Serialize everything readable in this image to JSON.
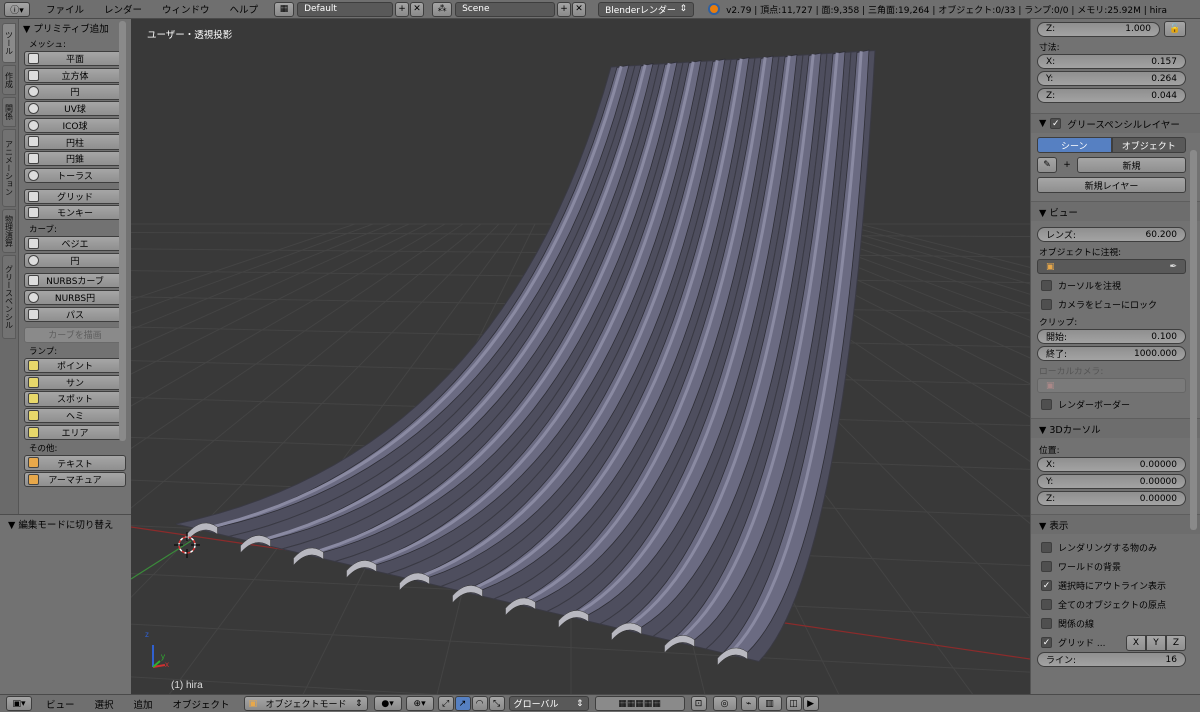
{
  "topbar": {
    "menus": [
      "ファイル",
      "レンダー",
      "ウィンドウ",
      "ヘルプ"
    ],
    "layout": "Default",
    "scene": "Scene",
    "engine": "Blenderレンダー",
    "stats": "v2.79 | 頂点:11,727 | 面:9,358 | 三角面:19,264 | オブジェクト:0/33 | ランプ:0/0 | メモリ:25.92M | hira"
  },
  "tabs": [
    "ツール",
    "作成",
    "関係",
    "アニメーション",
    "物理演算",
    "グリースペンシル"
  ],
  "tools": {
    "header": "▼ プリミティブ追加",
    "mesh_label": "メッシュ:",
    "mesh": [
      "平面",
      "立方体",
      "円",
      "UV球",
      "ICO球",
      "円柱",
      "円錐",
      "トーラス"
    ],
    "mesh2": [
      "グリッド",
      "モンキー"
    ],
    "curve_label": "カーブ:",
    "curve": [
      "ベジエ",
      "円"
    ],
    "curve2": [
      "NURBSカーブ",
      "NURBS円",
      "パス"
    ],
    "draw_curve": "カーブを描画",
    "lamp_label": "ランプ:",
    "lamp": [
      "ポイント",
      "サン",
      "スポット",
      "ヘミ",
      "エリア"
    ],
    "other_label": "その他:",
    "other": [
      "テキスト",
      "アーマチュア"
    ]
  },
  "operator_panel": "▼ 編集モードに切り替え",
  "viewport": {
    "view_name": "ユーザー・透視投影",
    "object_name": "(1) hira",
    "axis_x": "x",
    "axis_y": "y",
    "axis_z": "z"
  },
  "rpanel": {
    "z_top": {
      "label": "Z:",
      "value": "1.000"
    },
    "dims_label": "寸法:",
    "dims": [
      {
        "k": "X:",
        "v": "0.157"
      },
      {
        "k": "Y:",
        "v": "0.264"
      },
      {
        "k": "Z:",
        "v": "0.044"
      }
    ],
    "gp_header": "グリースペンシルレイヤー",
    "gp_scene": "シーン",
    "gp_object": "オブジェクト",
    "gp_new": "新規",
    "gp_new_layer": "新規レイヤー",
    "view_header": "▼ ビュー",
    "lens": {
      "k": "レンズ:",
      "v": "60.200"
    },
    "lock_object": "オブジェクトに注視:",
    "lock_cursor": "カーソルを注視",
    "lock_camera": "カメラをビューにロック",
    "clip_label": "クリップ:",
    "clip": [
      {
        "k": "開始:",
        "v": "0.100"
      },
      {
        "k": "終了:",
        "v": "1000.000"
      }
    ],
    "local_camera": "ローカルカメラ:",
    "render_border": "レンダーボーダー",
    "cursor_header": "▼ 3Dカーソル",
    "pos_label": "位置:",
    "pos": [
      {
        "k": "X:",
        "v": "0.00000"
      },
      {
        "k": "Y:",
        "v": "0.00000"
      },
      {
        "k": "Z:",
        "v": "0.00000"
      }
    ],
    "display_header": "▼ 表示",
    "display_checks": [
      {
        "label": "レンダリングする物のみ",
        "checked": false
      },
      {
        "label": "ワールドの背景",
        "checked": false
      },
      {
        "label": "選択時にアウトライン表示",
        "checked": true
      },
      {
        "label": "全てのオブジェクトの原点",
        "checked": false
      },
      {
        "label": "関係の線",
        "checked": false
      }
    ],
    "grid_floor": "グリッド ...",
    "grid_axes": [
      "X",
      "Y",
      "Z"
    ],
    "lines": {
      "k": "ライン:",
      "v": "16"
    }
  },
  "botbar": {
    "menus": [
      "ビュー",
      "選択",
      "追加",
      "オブジェクト"
    ],
    "mode": "オブジェクトモード",
    "orientation": "グローバル"
  },
  "colors": {
    "accent": "#5680c2",
    "viewport": "#393939",
    "panel": "#727272"
  }
}
